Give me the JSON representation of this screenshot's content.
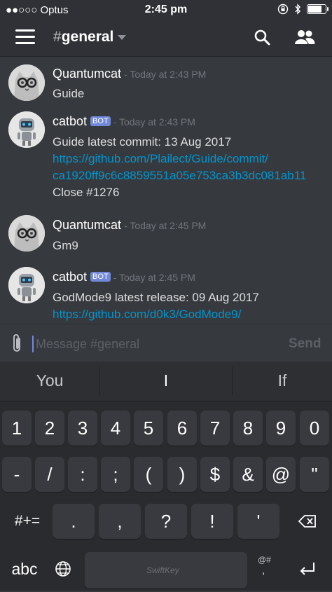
{
  "status": {
    "carrier": "●●○○○ Optus",
    "time": "2:45 pm",
    "battery_level": 0.85
  },
  "header": {
    "channel": "general",
    "hash": "#"
  },
  "messages": [
    {
      "user": "Quantumcat",
      "bot": false,
      "timestamp": "- Today at 2:43 PM",
      "lines": [
        {
          "text": "Guide",
          "link": false
        }
      ]
    },
    {
      "user": "catbot",
      "bot": true,
      "bot_label": "BOT",
      "timestamp": "- Today at 2:43 PM",
      "lines": [
        {
          "text": "Guide latest commit: 13 Aug 2017",
          "link": false
        },
        {
          "text": "https://github.com/Plailect/Guide/commit/",
          "link": true
        },
        {
          "text": "ca1920ff9c6c8859551a05e753ca3b3dc081ab11",
          "link": true
        },
        {
          "text": "Close #1276",
          "link": false
        }
      ]
    },
    {
      "user": "Quantumcat",
      "bot": false,
      "timestamp": "- Today at 2:45 PM",
      "lines": [
        {
          "text": "Gm9",
          "link": false
        }
      ]
    },
    {
      "user": "catbot",
      "bot": true,
      "bot_label": "BOT",
      "timestamp": "- Today at 2:45 PM",
      "lines": [
        {
          "text": "GodMode9 latest release: 09 Aug 2017",
          "link": false
        },
        {
          "text": "https://github.com/d0k3/GodMode9/",
          "link": true
        }
      ]
    }
  ],
  "composer": {
    "placeholder": "Message #general",
    "send_label": "Send"
  },
  "keyboard": {
    "predictions": [
      "You",
      "I",
      "If"
    ],
    "row1": [
      "1",
      "2",
      "3",
      "4",
      "5",
      "6",
      "7",
      "8",
      "9",
      "0"
    ],
    "row2": [
      "-",
      "/",
      ":",
      ";",
      "(",
      ")",
      "$",
      "&",
      "@",
      "\""
    ],
    "row3": [
      ".",
      ",",
      "?",
      "!",
      "'"
    ],
    "symbols_label": "#+=",
    "abc_label": "abc",
    "alt_label": "@#",
    "space_label": "SwiftKey"
  },
  "colors": {
    "accent": "#7289da",
    "link": "#0096cf",
    "background": "#36393e"
  }
}
